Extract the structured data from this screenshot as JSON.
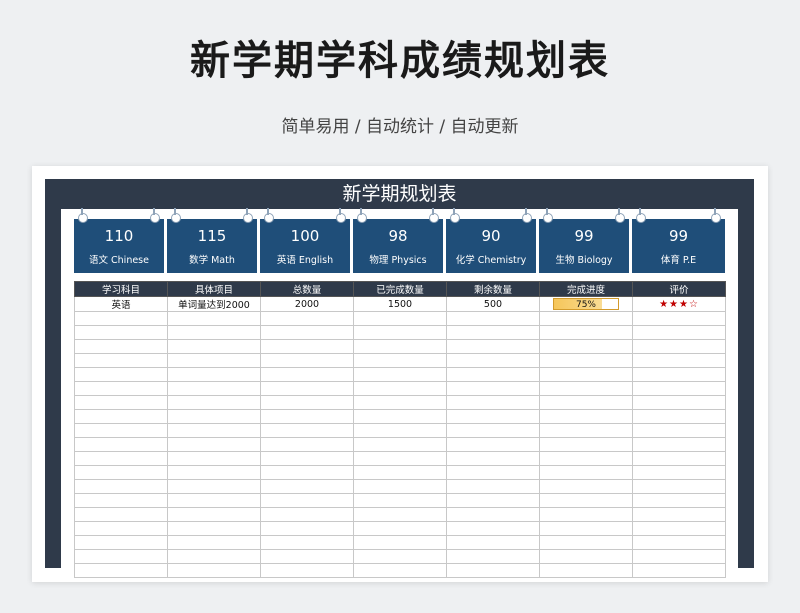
{
  "header": {
    "title": "新学期学科成绩规划表",
    "subtitle": "简单易用 / 自动统计 / 自动更新"
  },
  "sheet": {
    "title": "新学期规划表",
    "cards": [
      {
        "score": "110",
        "subject": "语文 Chinese"
      },
      {
        "score": "115",
        "subject": "数学  Math"
      },
      {
        "score": "100",
        "subject": "英语 English"
      },
      {
        "score": "98",
        "subject": "物理  Physics"
      },
      {
        "score": "90",
        "subject": "化学 Chemistry"
      },
      {
        "score": "99",
        "subject": "生物 Biology"
      },
      {
        "score": "99",
        "subject": "体育 P.E"
      }
    ],
    "table": {
      "headers": [
        "学习科目",
        "具体项目",
        "总数量",
        "已完成数量",
        "剩余数量",
        "完成进度",
        "评价"
      ],
      "rows": [
        {
          "subject": "英语",
          "item": "单词量达到2000",
          "total": "2000",
          "done": "1500",
          "remaining": "500",
          "progress": "75%",
          "progress_fraction": 0.75,
          "rating": "★★★☆"
        }
      ]
    }
  },
  "colors": {
    "frame": "#2f3a4a",
    "card": "#1f4e79",
    "progress": "#f6c65a",
    "star": "#c00000"
  }
}
